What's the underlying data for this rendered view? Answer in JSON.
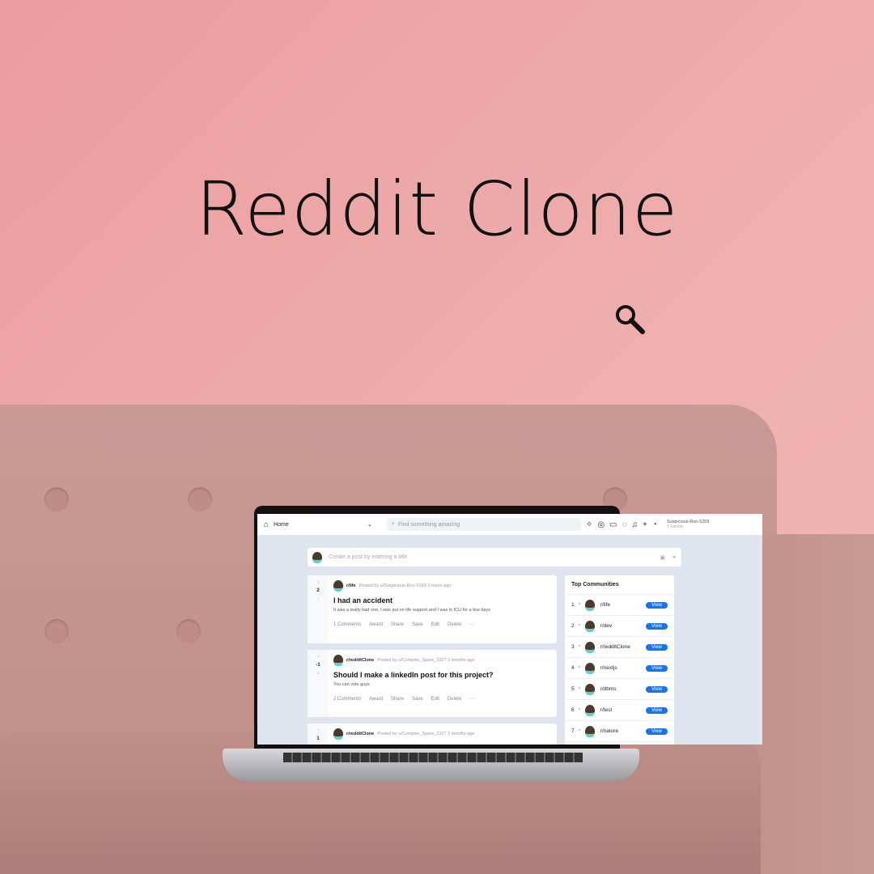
{
  "hero": {
    "title": "Reddit Clone",
    "icon": "magnifier-icon"
  },
  "header": {
    "home": "Home",
    "search_placeholder": "Find something amazing",
    "user": "Suspicious-Run-5269",
    "karma": "1 karma"
  },
  "create": {
    "placeholder": "Create a post by entering a title"
  },
  "posts": [
    {
      "votes": "2",
      "community": "r/life",
      "meta": "Posted by u/Suspicious-Run-5269 3 hours ago",
      "title": "I had an accident",
      "text": "It was a really bad one, I was put on life support and I was in ICU for a few days",
      "comments": "1 Comments"
    },
    {
      "votes": "-1",
      "community": "r/redditClone",
      "meta": "Posted by u/Complex_Spare_2327 2 months ago",
      "title": "Should I make a linkedIn post for this project?",
      "text": "You can vote guys",
      "comments": "2 Comments"
    },
    {
      "votes": "1",
      "community": "r/redditClone",
      "meta": "Posted by u/Complex_Spare_2327 2 months ago",
      "title": "",
      "text": "",
      "comments": ""
    }
  ],
  "actions": {
    "award": "Award",
    "share": "Share",
    "save": "Save",
    "edit": "Edit",
    "delete": "Delete",
    "more": "···"
  },
  "sidebar": {
    "title": "Top Communities",
    "view": "View",
    "items": [
      {
        "rank": "1",
        "name": "r/life"
      },
      {
        "rank": "2",
        "name": "r/dev"
      },
      {
        "rank": "3",
        "name": "r/redditClone"
      },
      {
        "rank": "4",
        "name": "r/nextjs"
      },
      {
        "rank": "5",
        "name": "r/dbms"
      },
      {
        "rank": "6",
        "name": "r/test"
      },
      {
        "rank": "7",
        "name": "r/nature"
      }
    ]
  }
}
